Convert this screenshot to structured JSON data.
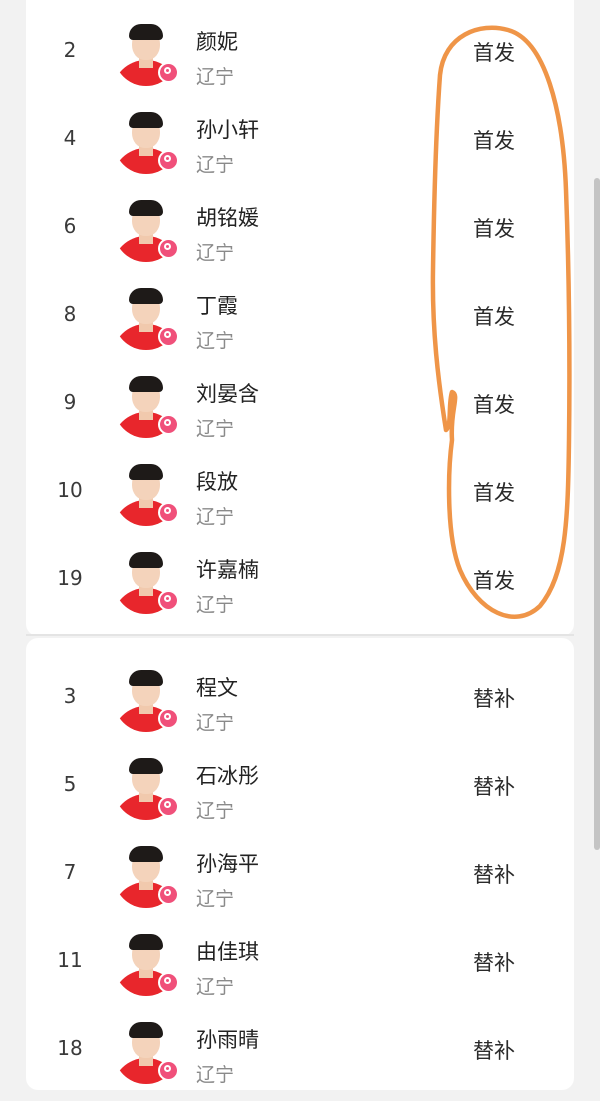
{
  "starters": [
    {
      "number": "2",
      "name": "颜妮",
      "team": "辽宁",
      "role": "首发"
    },
    {
      "number": "4",
      "name": "孙小轩",
      "team": "辽宁",
      "role": "首发"
    },
    {
      "number": "6",
      "name": "胡铭媛",
      "team": "辽宁",
      "role": "首发"
    },
    {
      "number": "8",
      "name": "丁霞",
      "team": "辽宁",
      "role": "首发"
    },
    {
      "number": "9",
      "name": "刘晏含",
      "team": "辽宁",
      "role": "首发"
    },
    {
      "number": "10",
      "name": "段放",
      "team": "辽宁",
      "role": "首发"
    },
    {
      "number": "19",
      "name": "许嘉楠",
      "team": "辽宁",
      "role": "首发"
    }
  ],
  "substitutes": [
    {
      "number": "3",
      "name": "程文",
      "team": "辽宁",
      "role": "替补"
    },
    {
      "number": "5",
      "name": "石冰彤",
      "team": "辽宁",
      "role": "替补"
    },
    {
      "number": "7",
      "name": "孙海平",
      "team": "辽宁",
      "role": "替补"
    },
    {
      "number": "11",
      "name": "由佳琪",
      "team": "辽宁",
      "role": "替补"
    },
    {
      "number": "18",
      "name": "孙雨晴",
      "team": "辽宁",
      "role": "替补"
    }
  ],
  "colors": {
    "jersey": "#e8262c",
    "annotation_stroke": "#ef9548",
    "badge": "#f0507a"
  },
  "icons": {
    "avatar": "player-avatar",
    "badge": "search-icon"
  }
}
